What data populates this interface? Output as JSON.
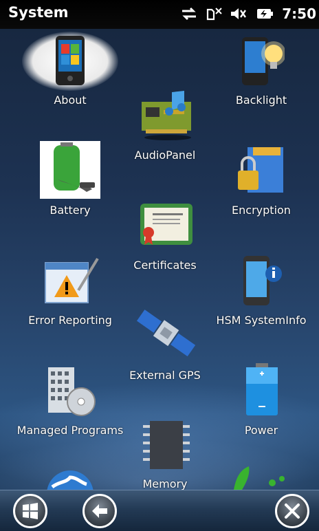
{
  "statusbar": {
    "title": "System",
    "time": "7:50",
    "icons": [
      "sync-arrows-icon",
      "signal-icon",
      "volume-icon",
      "battery-charging-icon"
    ]
  },
  "apps": [
    {
      "label": "About",
      "icon": "phone-windows-icon"
    },
    {
      "label": "Backlight",
      "icon": "phone-lightbulb-icon"
    },
    {
      "label": "AudioPanel",
      "icon": "audio-card-icon"
    },
    {
      "label": "Battery",
      "icon": "battery-plug-icon"
    },
    {
      "label": "Encryption",
      "icon": "sdcard-lock-icon"
    },
    {
      "label": "Certificates",
      "icon": "certificate-icon"
    },
    {
      "label": "Error Reporting",
      "icon": "warning-pen-icon"
    },
    {
      "label": "HSM SystemInfo",
      "icon": "device-info-icon"
    },
    {
      "label": "External GPS",
      "icon": "satellite-icon"
    },
    {
      "label": "Managed Programs",
      "icon": "building-disc-icon"
    },
    {
      "label": "Power",
      "icon": "battery-blue-icon"
    },
    {
      "label": "Memory",
      "icon": "chip-icon"
    }
  ],
  "bottombar": {
    "start": "windows-start-icon",
    "back": "back-arrow-icon",
    "close": "close-icon"
  }
}
